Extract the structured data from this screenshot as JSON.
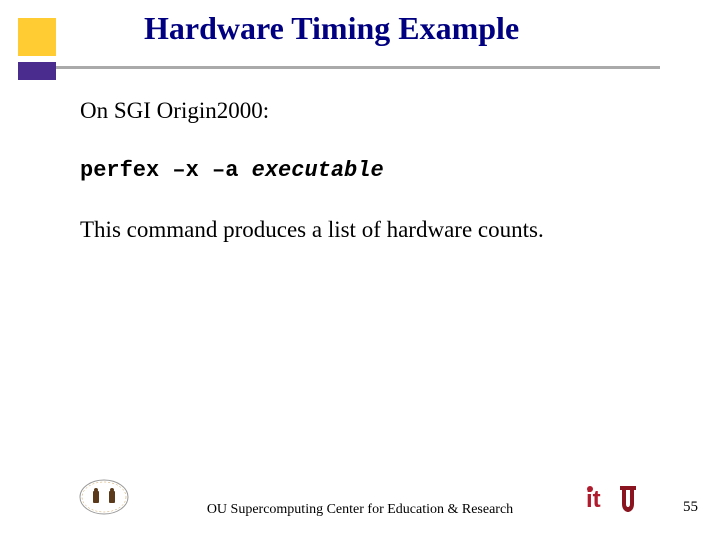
{
  "title": "Hardware Timing Example",
  "content": {
    "line1": "On SGI Origin2000:",
    "code_cmd": "perfex –x –a",
    "code_arg": "executable",
    "line3": "This command produces a list of hardware counts."
  },
  "footer": {
    "text": "OU Supercomputing Center for Education & Research",
    "page": "55"
  },
  "colors": {
    "title": "#000080",
    "yellow": "#ffcc33",
    "purple": "#4a2c8f",
    "ou_red": "#8a1520",
    "it_red": "#b01c2e"
  }
}
